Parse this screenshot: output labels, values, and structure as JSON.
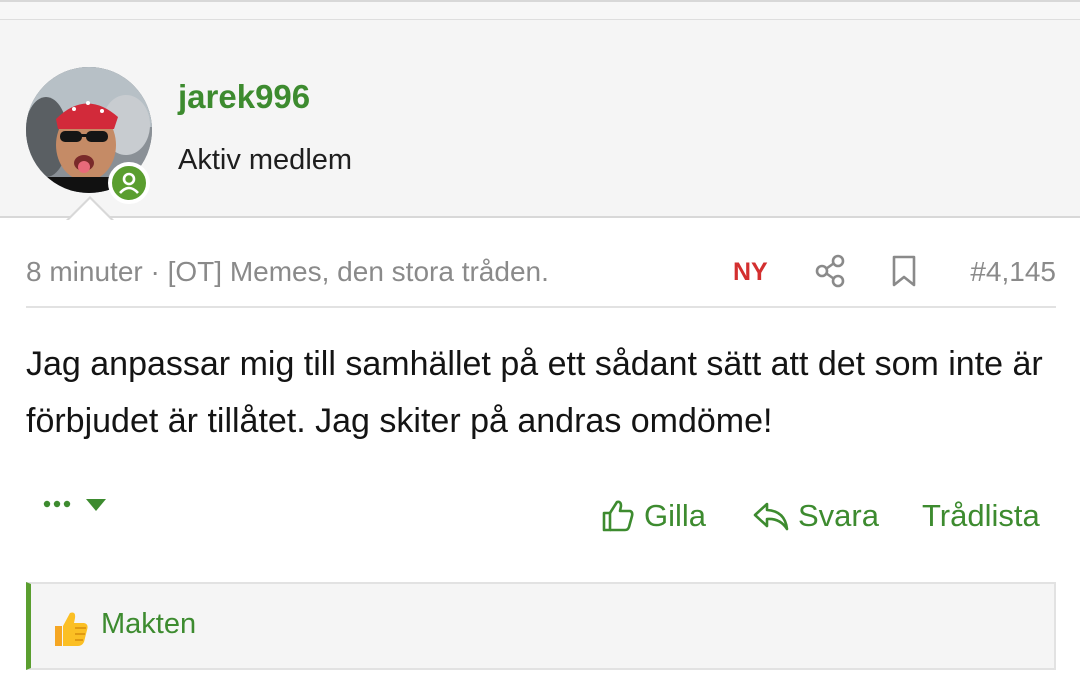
{
  "user": {
    "name": "jarek996",
    "title": "Aktiv medlem"
  },
  "post": {
    "meta": "8 minuter · [OT] Memes, den stora tråden.",
    "new_badge": "NY",
    "number": "#4,145",
    "body": "Jag anpassar mig till samhället på ett sådant sätt att det som inte är förbjudet är tillåtet. Jag skiter på andras omdöme!"
  },
  "actions": {
    "like": "Gilla",
    "reply": "Svara",
    "thread_list": "Trådlista"
  },
  "reactions": {
    "user": "Makten"
  },
  "colors": {
    "accent_green": "#3d8b2f",
    "online_green": "#5a9e2f",
    "new_red": "#d32f2f",
    "meta_gray": "#8a8a8a"
  }
}
